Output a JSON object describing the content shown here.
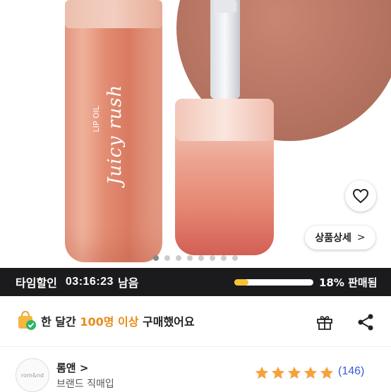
{
  "colors": {
    "accent_orange": "#e88b1a",
    "star": "#f6a23a",
    "progress_fill": "#f5c431",
    "review_link": "#3a5bd6",
    "timebar_bg": "#1b1b1d"
  },
  "product_image": {
    "brand_text": "Juicy rush",
    "sub_text": "LIP OIL",
    "detail_button": "상품상세",
    "detail_chevron": ">",
    "heart_icon": "heart-outline-icon",
    "carousel": {
      "total": 8,
      "active_index": 0
    }
  },
  "timebar": {
    "label": "타임할인",
    "time": "03:16:23",
    "suffix": "남음",
    "sold_percent": 0.18,
    "sold_text": "18% 판매됨"
  },
  "purchase_info": {
    "prefix": "한 달간 ",
    "highlight": "100명 이상",
    "suffix": " 구매했어요",
    "bag_icon": "shopping-bag-check-icon",
    "gift_icon": "gift-icon",
    "share_icon": "share-icon"
  },
  "seller": {
    "name": "롬앤 >",
    "subtitle": "브랜드 직매입",
    "avatar_text": "rom&nd",
    "rating": 5,
    "review_count": "(146)"
  }
}
